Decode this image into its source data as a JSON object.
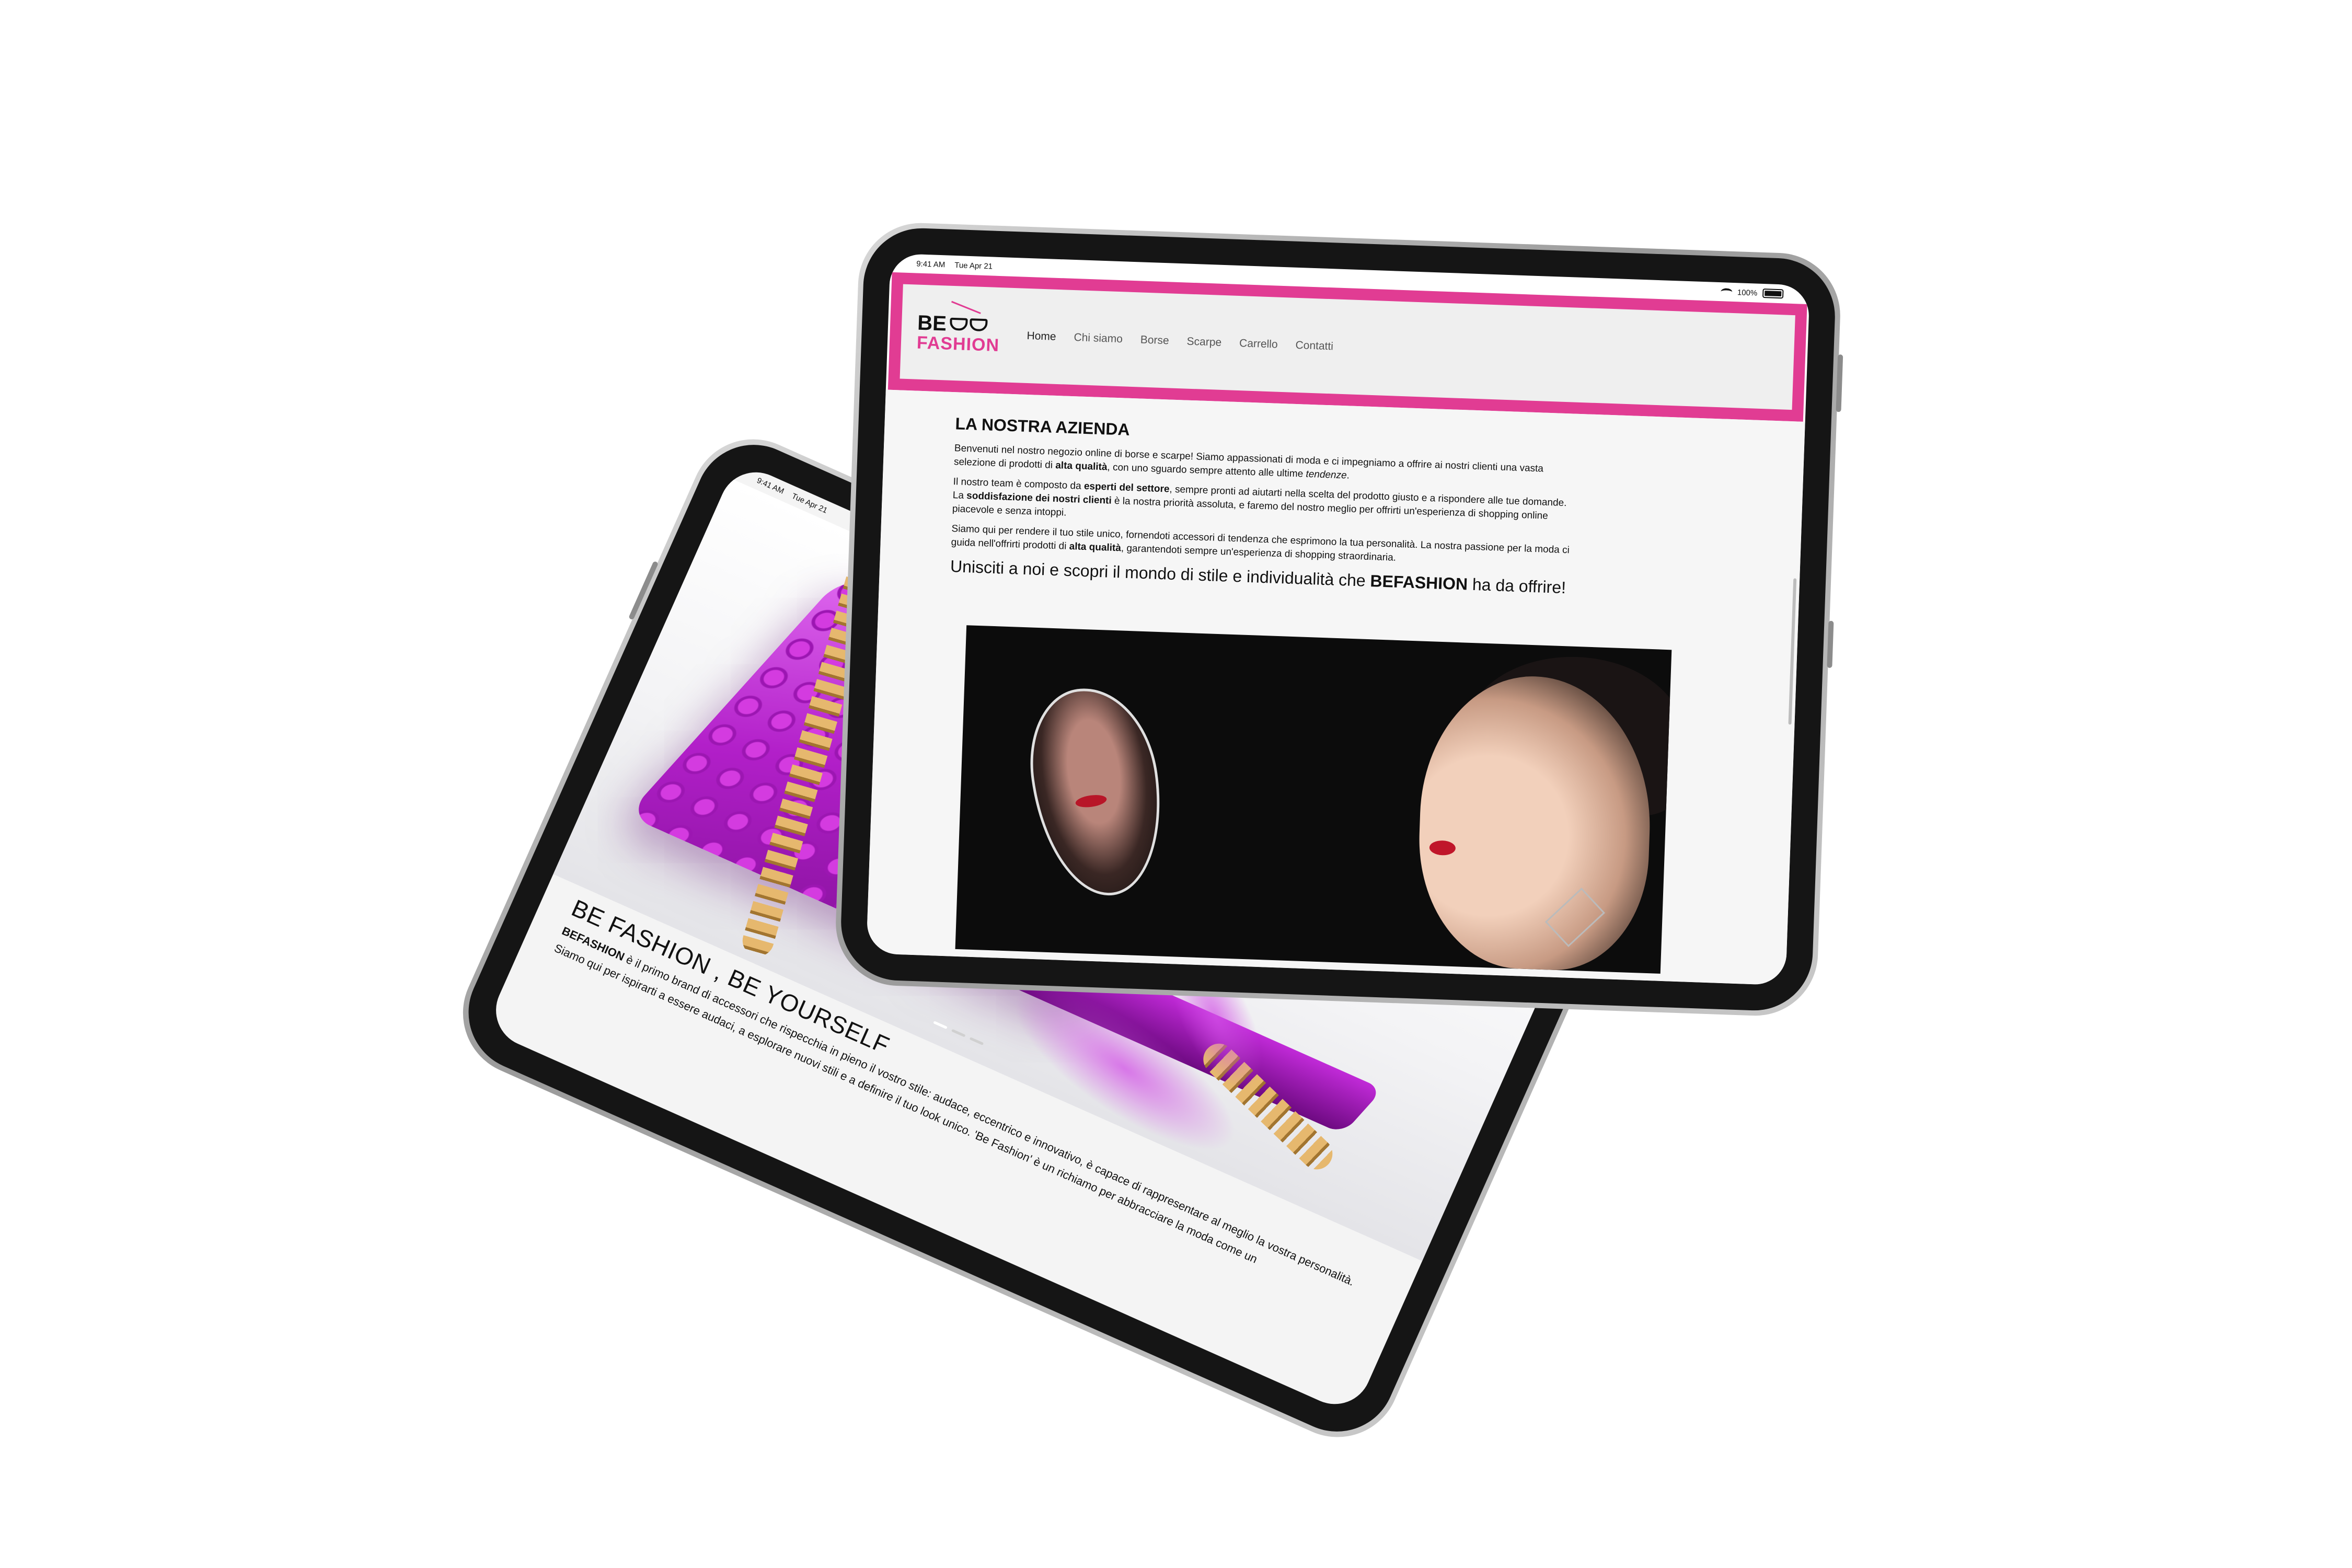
{
  "status_bar": {
    "time": "9:41 AM",
    "date": "Tue Apr 21",
    "battery": "100%"
  },
  "back_site": {
    "title": "BE FASHION , BE YOURSELF",
    "p1_brand": "BEFASHION",
    "p1_rest": " è il primo brand di accessori che rispecchia in pieno il vostro stile: audace, eccentrico e innovativo, è capace di rappresentare al meglio la vostra personalità.",
    "p2": "Siamo qui per ispirarti a essere audaci, a esplorare nuovi stili e a definire il tuo look unico. 'Be Fashion' è un richiamo per abbracciare la moda come un"
  },
  "front_site": {
    "logo": {
      "be": "BE",
      "fashion": "FASHION"
    },
    "nav": [
      {
        "label": "Home",
        "active": true
      },
      {
        "label": "Chi siamo"
      },
      {
        "label": "Borse"
      },
      {
        "label": "Scarpe"
      },
      {
        "label": "Carrello"
      },
      {
        "label": "Contatti"
      }
    ],
    "heading": "LA NOSTRA AZIENDA",
    "p1_a": "Benvenuti nel nostro negozio online di borse e scarpe! Siamo appassionati di moda e ci impegniamo a offrire ai nostri clienti una vasta selezione di prodotti di ",
    "p1_b": "alta qualità",
    "p1_c": ", con uno sguardo sempre attento alle ultime ",
    "p1_d": "tendenze",
    "p1_e": ".",
    "p2_a": "Il nostro team è composto da ",
    "p2_b": "esperti del settore",
    "p2_c": ", sempre pronti ad aiutarti nella scelta del prodotto giusto e a rispondere alle tue domande. La ",
    "p2_d": "soddisfazione dei nostri clienti",
    "p2_e": " è la nostra priorità assoluta, e faremo del nostro meglio per offrirti un'esperienza di shopping online piacevole e senza intoppi.",
    "p3_a": "Siamo qui per rendere il tuo stile unico, fornendoti accessori di tendenza che esprimono la tua personalità. La nostra passione per la moda ci guida nell'offrirti prodotti di ",
    "p3_b": "alta qualità",
    "p3_c": ", garantendoti sempre un'esperienza di shopping straordinaria.",
    "p4_a": "Unisciti a noi e scopri il mondo di stile e individualità che ",
    "p4_b": "BEFASHION",
    "p4_c": " ha da offrire!"
  },
  "colors": {
    "brand_pink": "#e13c93",
    "purple": "#b21fc9",
    "text": "#111111"
  },
  "icons": [
    "wifi-icon",
    "battery-icon",
    "glasses-logo-icon"
  ]
}
